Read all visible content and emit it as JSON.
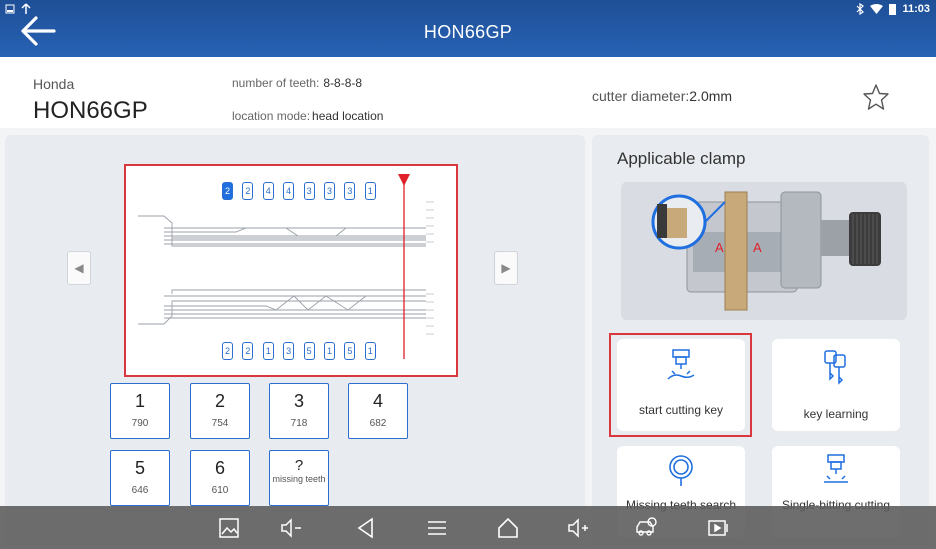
{
  "status": {
    "time": "11:03"
  },
  "header": {
    "title": "HON66GP"
  },
  "info": {
    "brand": "Honda",
    "model": "HON66GP",
    "teeth_label": "number of teeth:",
    "teeth_value": "8-8-8-8",
    "location_label": "location mode:",
    "location_value": "head location",
    "cutter_label": "cutter diameter:",
    "cutter_value": "2.0mm"
  },
  "diagram": {
    "top_teeth": [
      "2",
      "2",
      "4",
      "4",
      "3",
      "3",
      "3",
      "1"
    ],
    "bottom_teeth": [
      "2",
      "2",
      "1",
      "3",
      "5",
      "1",
      "5",
      "1"
    ],
    "active_index": 0
  },
  "keypad": [
    {
      "num": "1",
      "sub": "790"
    },
    {
      "num": "2",
      "sub": "754"
    },
    {
      "num": "3",
      "sub": "718"
    },
    {
      "num": "4",
      "sub": "682"
    },
    {
      "num": "5",
      "sub": "646"
    },
    {
      "num": "6",
      "sub": "610"
    },
    {
      "num": "?",
      "sub": "missing teeth"
    }
  ],
  "clamp": {
    "title": "Applicable clamp",
    "marker": "A"
  },
  "actions": {
    "start_cutting": "start cutting key",
    "key_learning": "key learning",
    "missing_search": "Missing teeth search",
    "single_bitting": "Single-bitting cutting"
  },
  "colors": {
    "accent": "#2a6ecf",
    "highlight": "#d9363e",
    "topbar": "#2762b4"
  }
}
